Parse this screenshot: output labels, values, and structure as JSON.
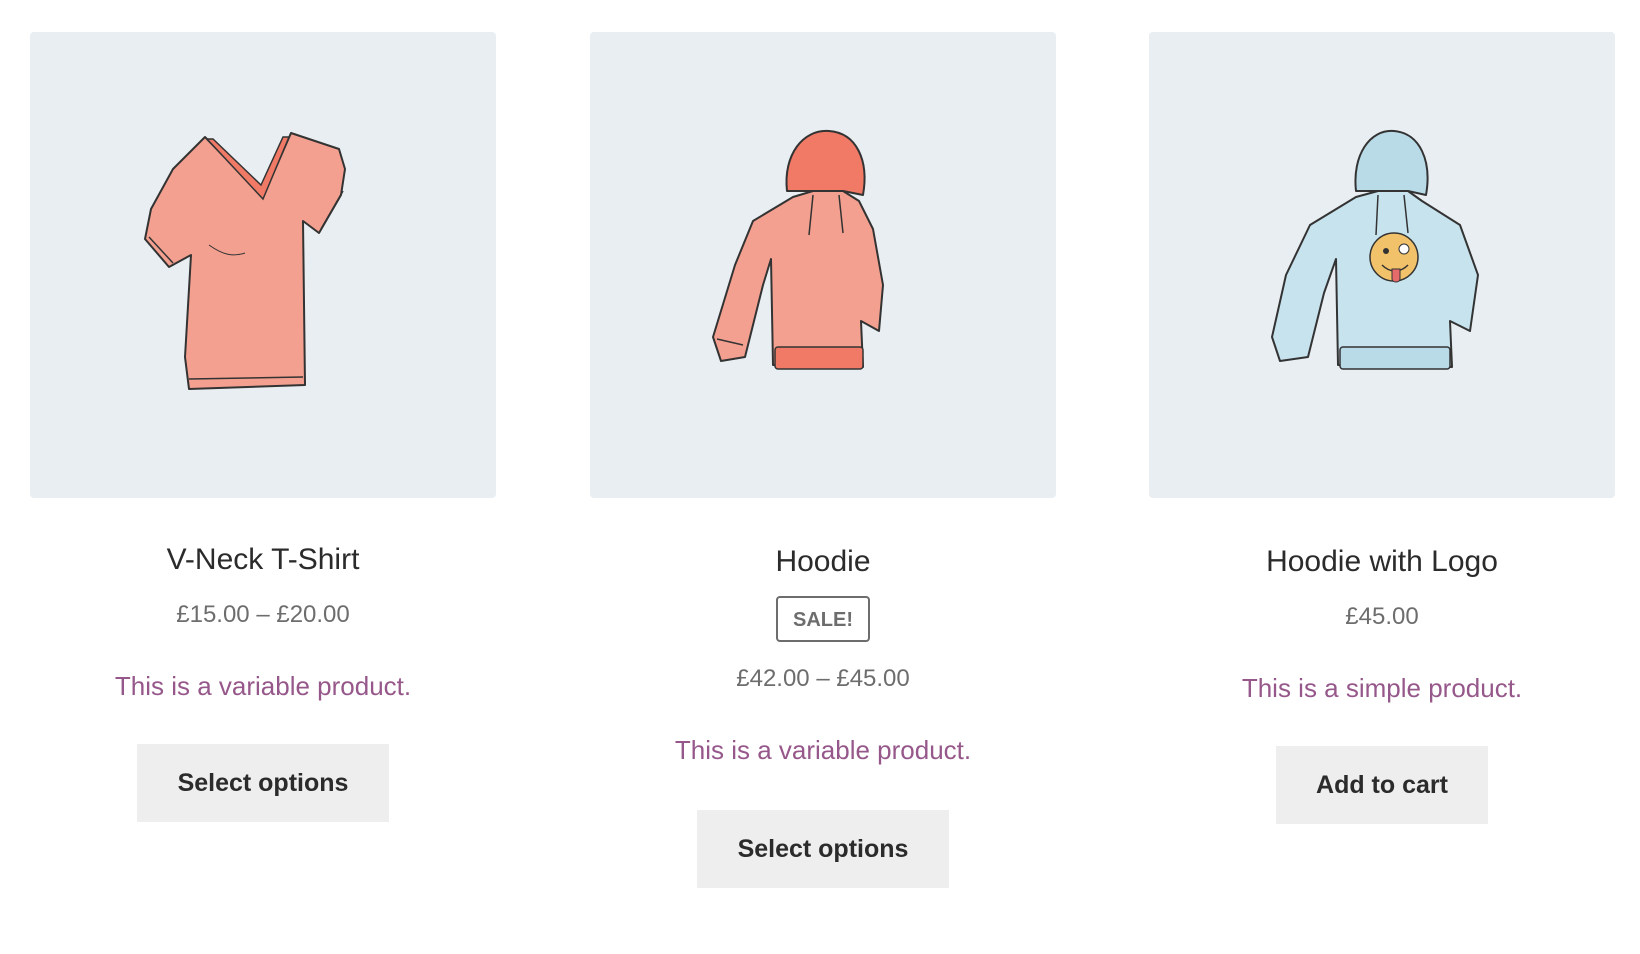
{
  "products": [
    {
      "image": "v-neck-tshirt-illustration",
      "title": "V-Neck T-Shirt",
      "price": "£15.00 – £20.00",
      "description": "This is a variable product.",
      "button_label": "Select options"
    },
    {
      "image": "hoodie-illustration",
      "title": "Hoodie",
      "sale_badge": "SALE!",
      "price": "£42.00 – £45.00",
      "description": "This is a variable product.",
      "button_label": "Select options"
    },
    {
      "image": "hoodie-with-logo-illustration",
      "title": "Hoodie with Logo",
      "price": "£45.00",
      "description": "This is a simple product.",
      "button_label": "Add to cart"
    }
  ],
  "colors": {
    "thumb_bg": "#e9eef2",
    "link_purple": "#96588a",
    "price_gray": "#6d6d6d",
    "button_bg": "#eeeeee",
    "salmon": "#f4a090",
    "light_blue": "#b9dbe8"
  }
}
